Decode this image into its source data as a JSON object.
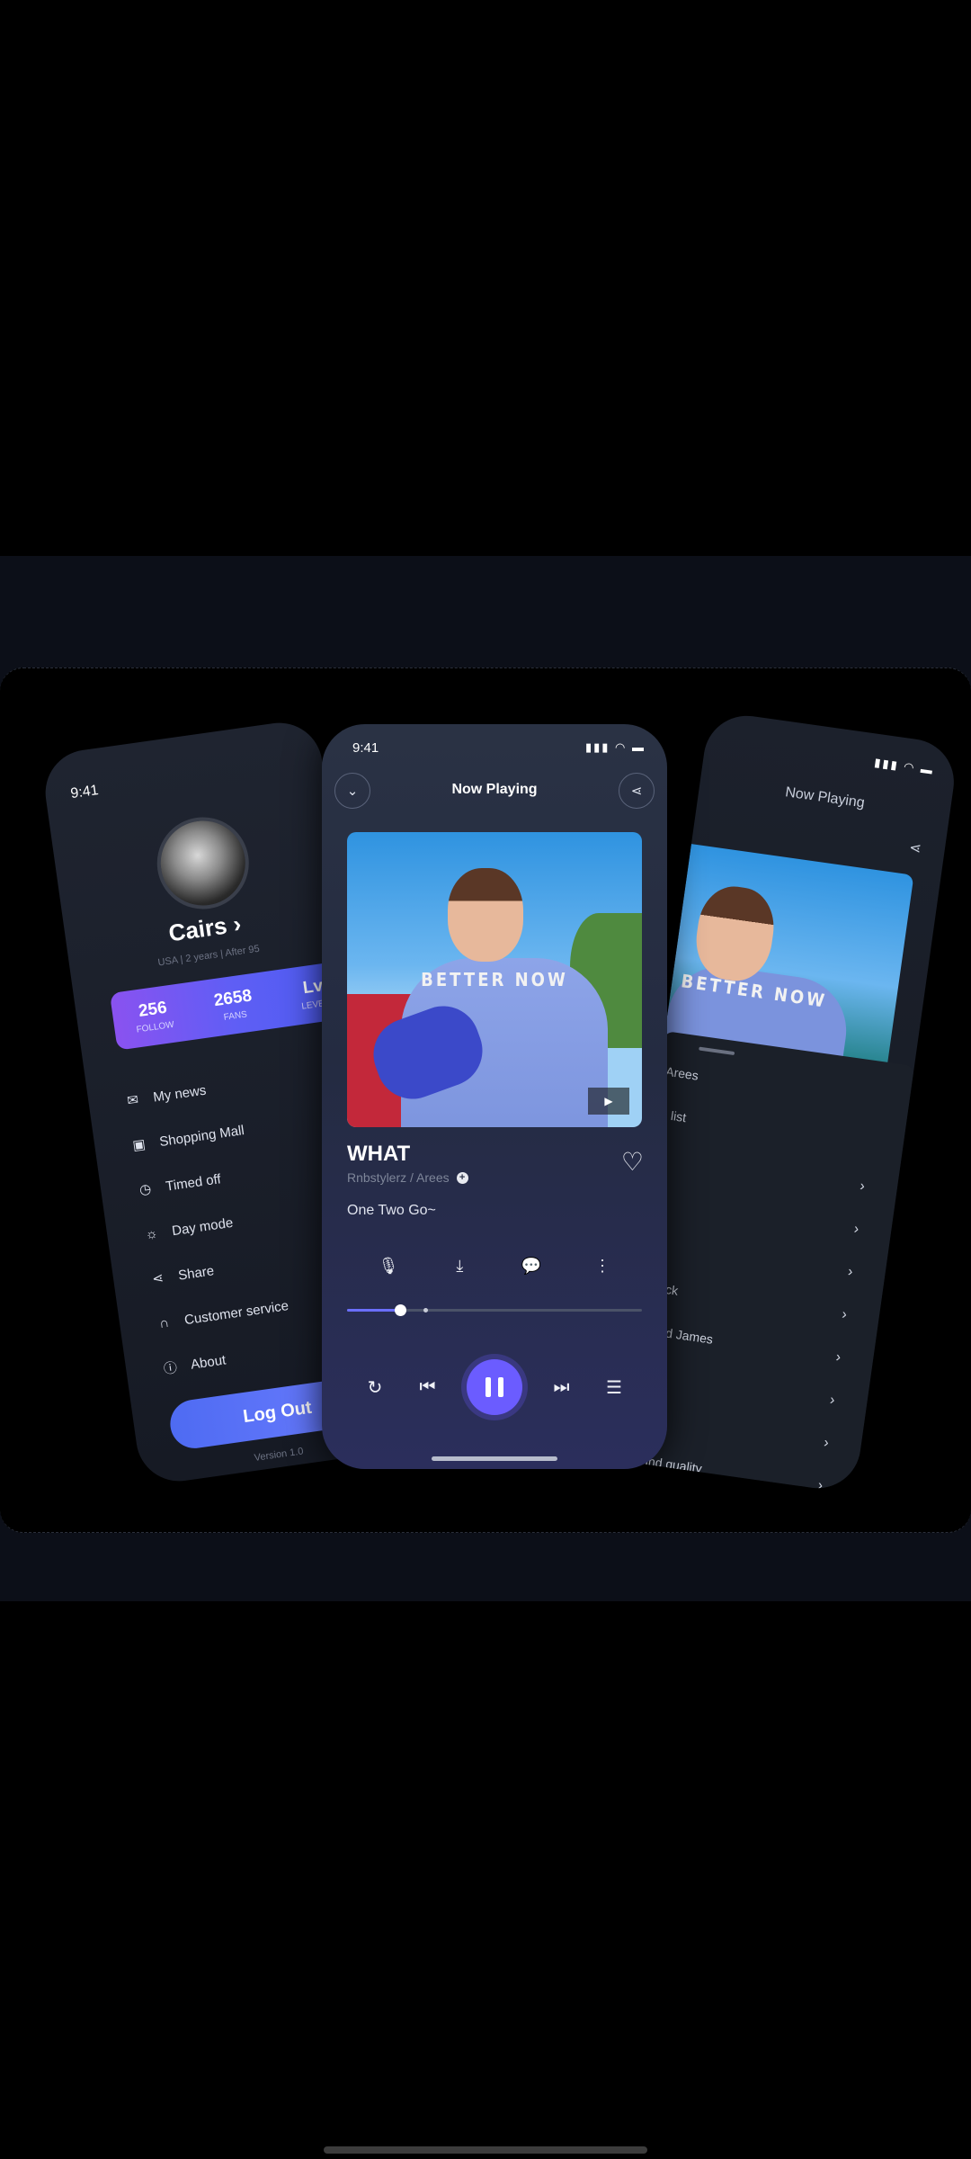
{
  "left_phone": {
    "time": "9:41",
    "name": "Cairs",
    "meta": "USA  |  2 years  |  After 95",
    "stats": [
      {
        "value": "256",
        "label": "FOLLOW"
      },
      {
        "value": "2658",
        "label": "FANS"
      },
      {
        "value": "Lv",
        "label": "LEVEL"
      }
    ],
    "menu": [
      {
        "label": "My news",
        "icon": "message-icon"
      },
      {
        "label": "Shopping Mall",
        "icon": "bag-icon"
      },
      {
        "label": "Timed off",
        "icon": "clock-icon"
      },
      {
        "label": "Day mode",
        "icon": "sun-icon"
      },
      {
        "label": "Share",
        "icon": "share-icon"
      },
      {
        "label": "Customer service",
        "icon": "headset-icon"
      },
      {
        "label": "About",
        "icon": "info-icon"
      }
    ],
    "logout_label": "Log Out",
    "version": "Version 1.0"
  },
  "center_phone": {
    "time": "9:41",
    "title": "Now Playing",
    "art_text": "BETTER NOW",
    "song": "WHAT",
    "artist": "Rnbstylerz / Arees",
    "lyric": "One Two Go~",
    "progress": 0.18,
    "buffered": 0.26
  },
  "right_phone": {
    "title": "Now Playing",
    "art_text": "BETTER NOW",
    "rows": [
      {
        "label": "/ Arees",
        "chevron": false
      },
      {
        "label": "ng list",
        "chevron": false
      },
      {
        "label": "",
        "chevron": true
      },
      {
        "label": "",
        "chevron": true
      },
      {
        "label": "",
        "chevron": true
      },
      {
        "label": "llue/Jack",
        "chevron": true
      },
      {
        "label": "t.Edward James",
        "chevron": true
      },
      {
        "label": "",
        "chevron": true
      },
      {
        "label": "",
        "chevron": true
      },
      {
        "label": "oss sound quality",
        "chevron": true
      }
    ]
  }
}
